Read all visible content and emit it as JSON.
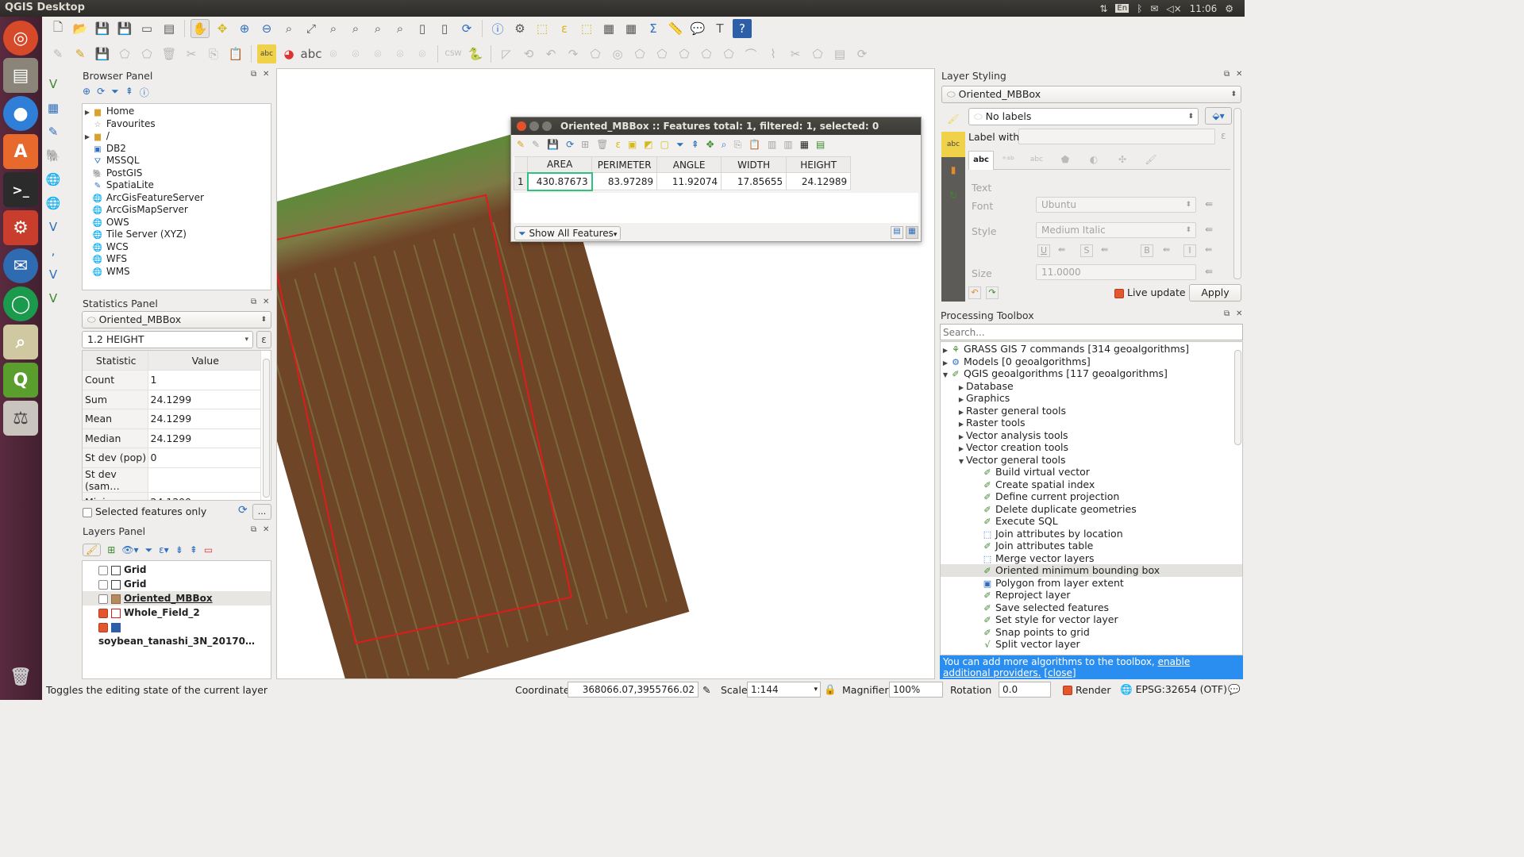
{
  "window": {
    "title": "QGIS Desktop",
    "clock": "11:06",
    "kbd": "En"
  },
  "browser": {
    "title": "Browser Panel",
    "items": [
      "Home",
      "Favourites",
      "/",
      "DB2",
      "MSSQL",
      "PostGIS",
      "SpatiaLite",
      "ArcGisFeatureServer",
      "ArcGisMapServer",
      "OWS",
      "Tile Server (XYZ)",
      "WCS",
      "WFS",
      "WMS"
    ]
  },
  "stats": {
    "title": "Statistics Panel",
    "layer": "Oriented_MBBox",
    "field": "1.2 HEIGHT",
    "headers": [
      "Statistic",
      "Value"
    ],
    "rows": [
      {
        "s": "Count",
        "v": "1"
      },
      {
        "s": "Sum",
        "v": "24.1299"
      },
      {
        "s": "Mean",
        "v": "24.1299"
      },
      {
        "s": "Median",
        "v": "24.1299"
      },
      {
        "s": "St dev (pop)",
        "v": "0"
      },
      {
        "s": "St dev (sam…",
        "v": ""
      },
      {
        "s": "Minimum",
        "v": "24.1299"
      }
    ],
    "selected_only": "Selected features only",
    "more": "..."
  },
  "layers": {
    "title": "Layers Panel",
    "items": [
      {
        "name": "Grid",
        "checked": false
      },
      {
        "name": "Grid",
        "checked": false
      },
      {
        "name": "Oriented_MBBox",
        "checked": false
      },
      {
        "name": "Whole_Field_2",
        "checked": true
      },
      {
        "name": "soybean_tanashi_3N_20170…",
        "checked": true
      }
    ]
  },
  "attr": {
    "title": "Oriented_MBBox :: Features total: 1, filtered: 1, selected: 0",
    "headers": [
      "AREA",
      "PERIMETER",
      "ANGLE",
      "WIDTH",
      "HEIGHT"
    ],
    "row_num": "1",
    "row": [
      "430.87673",
      "83.97289",
      "11.92074",
      "17.85655",
      "24.12989"
    ],
    "filter": "Show All Features"
  },
  "styling": {
    "title": "Layer Styling",
    "layer": "Oriented_MBBox",
    "labels_mode": "No labels",
    "label_with": "Label with",
    "tabs": [
      "abc"
    ],
    "text_heading": "Text",
    "font_label": "Font",
    "font": "Ubuntu",
    "style_label": "Style",
    "style": "Medium Italic",
    "size_label": "Size",
    "size": "11.0000",
    "live_update": "Live update",
    "apply": "Apply",
    "fmt": [
      "U",
      "S",
      "B",
      "I"
    ]
  },
  "toolbox": {
    "title": "Processing Toolbox",
    "search_placeholder": "Search...",
    "top": [
      {
        "label": "GRASS GIS 7 commands [314 geoalgorithms]",
        "open": false
      },
      {
        "label": "Models [0 geoalgorithms]",
        "open": false
      },
      {
        "label": "QGIS geoalgorithms [117 geoalgorithms]",
        "open": true
      }
    ],
    "groups": [
      "Database",
      "Graphics",
      "Raster general tools",
      "Raster tools",
      "Vector analysis tools",
      "Vector creation tools"
    ],
    "open_group": "Vector general tools",
    "algorithms": [
      "Build virtual vector",
      "Create spatial index",
      "Define current projection",
      "Delete duplicate geometries",
      "Execute SQL",
      "Join attributes by location",
      "Join attributes table",
      "Merge vector layers",
      "Oriented minimum bounding box",
      "Polygon from layer extent",
      "Reproject layer",
      "Save selected features",
      "Set style for vector layer",
      "Snap points to grid",
      "Split vector layer"
    ],
    "selected": "Oriented minimum bounding box",
    "notice": "You can add more algorithms to the toolbox,",
    "notice_link": "enable additional providers.",
    "notice_close": "[close]"
  },
  "status": {
    "message": "Toggles the editing state of the current layer",
    "coord_label": "Coordinate",
    "coord": "368066.07,3955766.02",
    "scale_label": "Scale",
    "scale": "1:144",
    "magnifier_label": "Magnifier",
    "magnifier": "100%",
    "rotation_label": "Rotation",
    "rotation": "0.0",
    "render": "Render",
    "crs": "EPSG:32654 (OTF)"
  }
}
